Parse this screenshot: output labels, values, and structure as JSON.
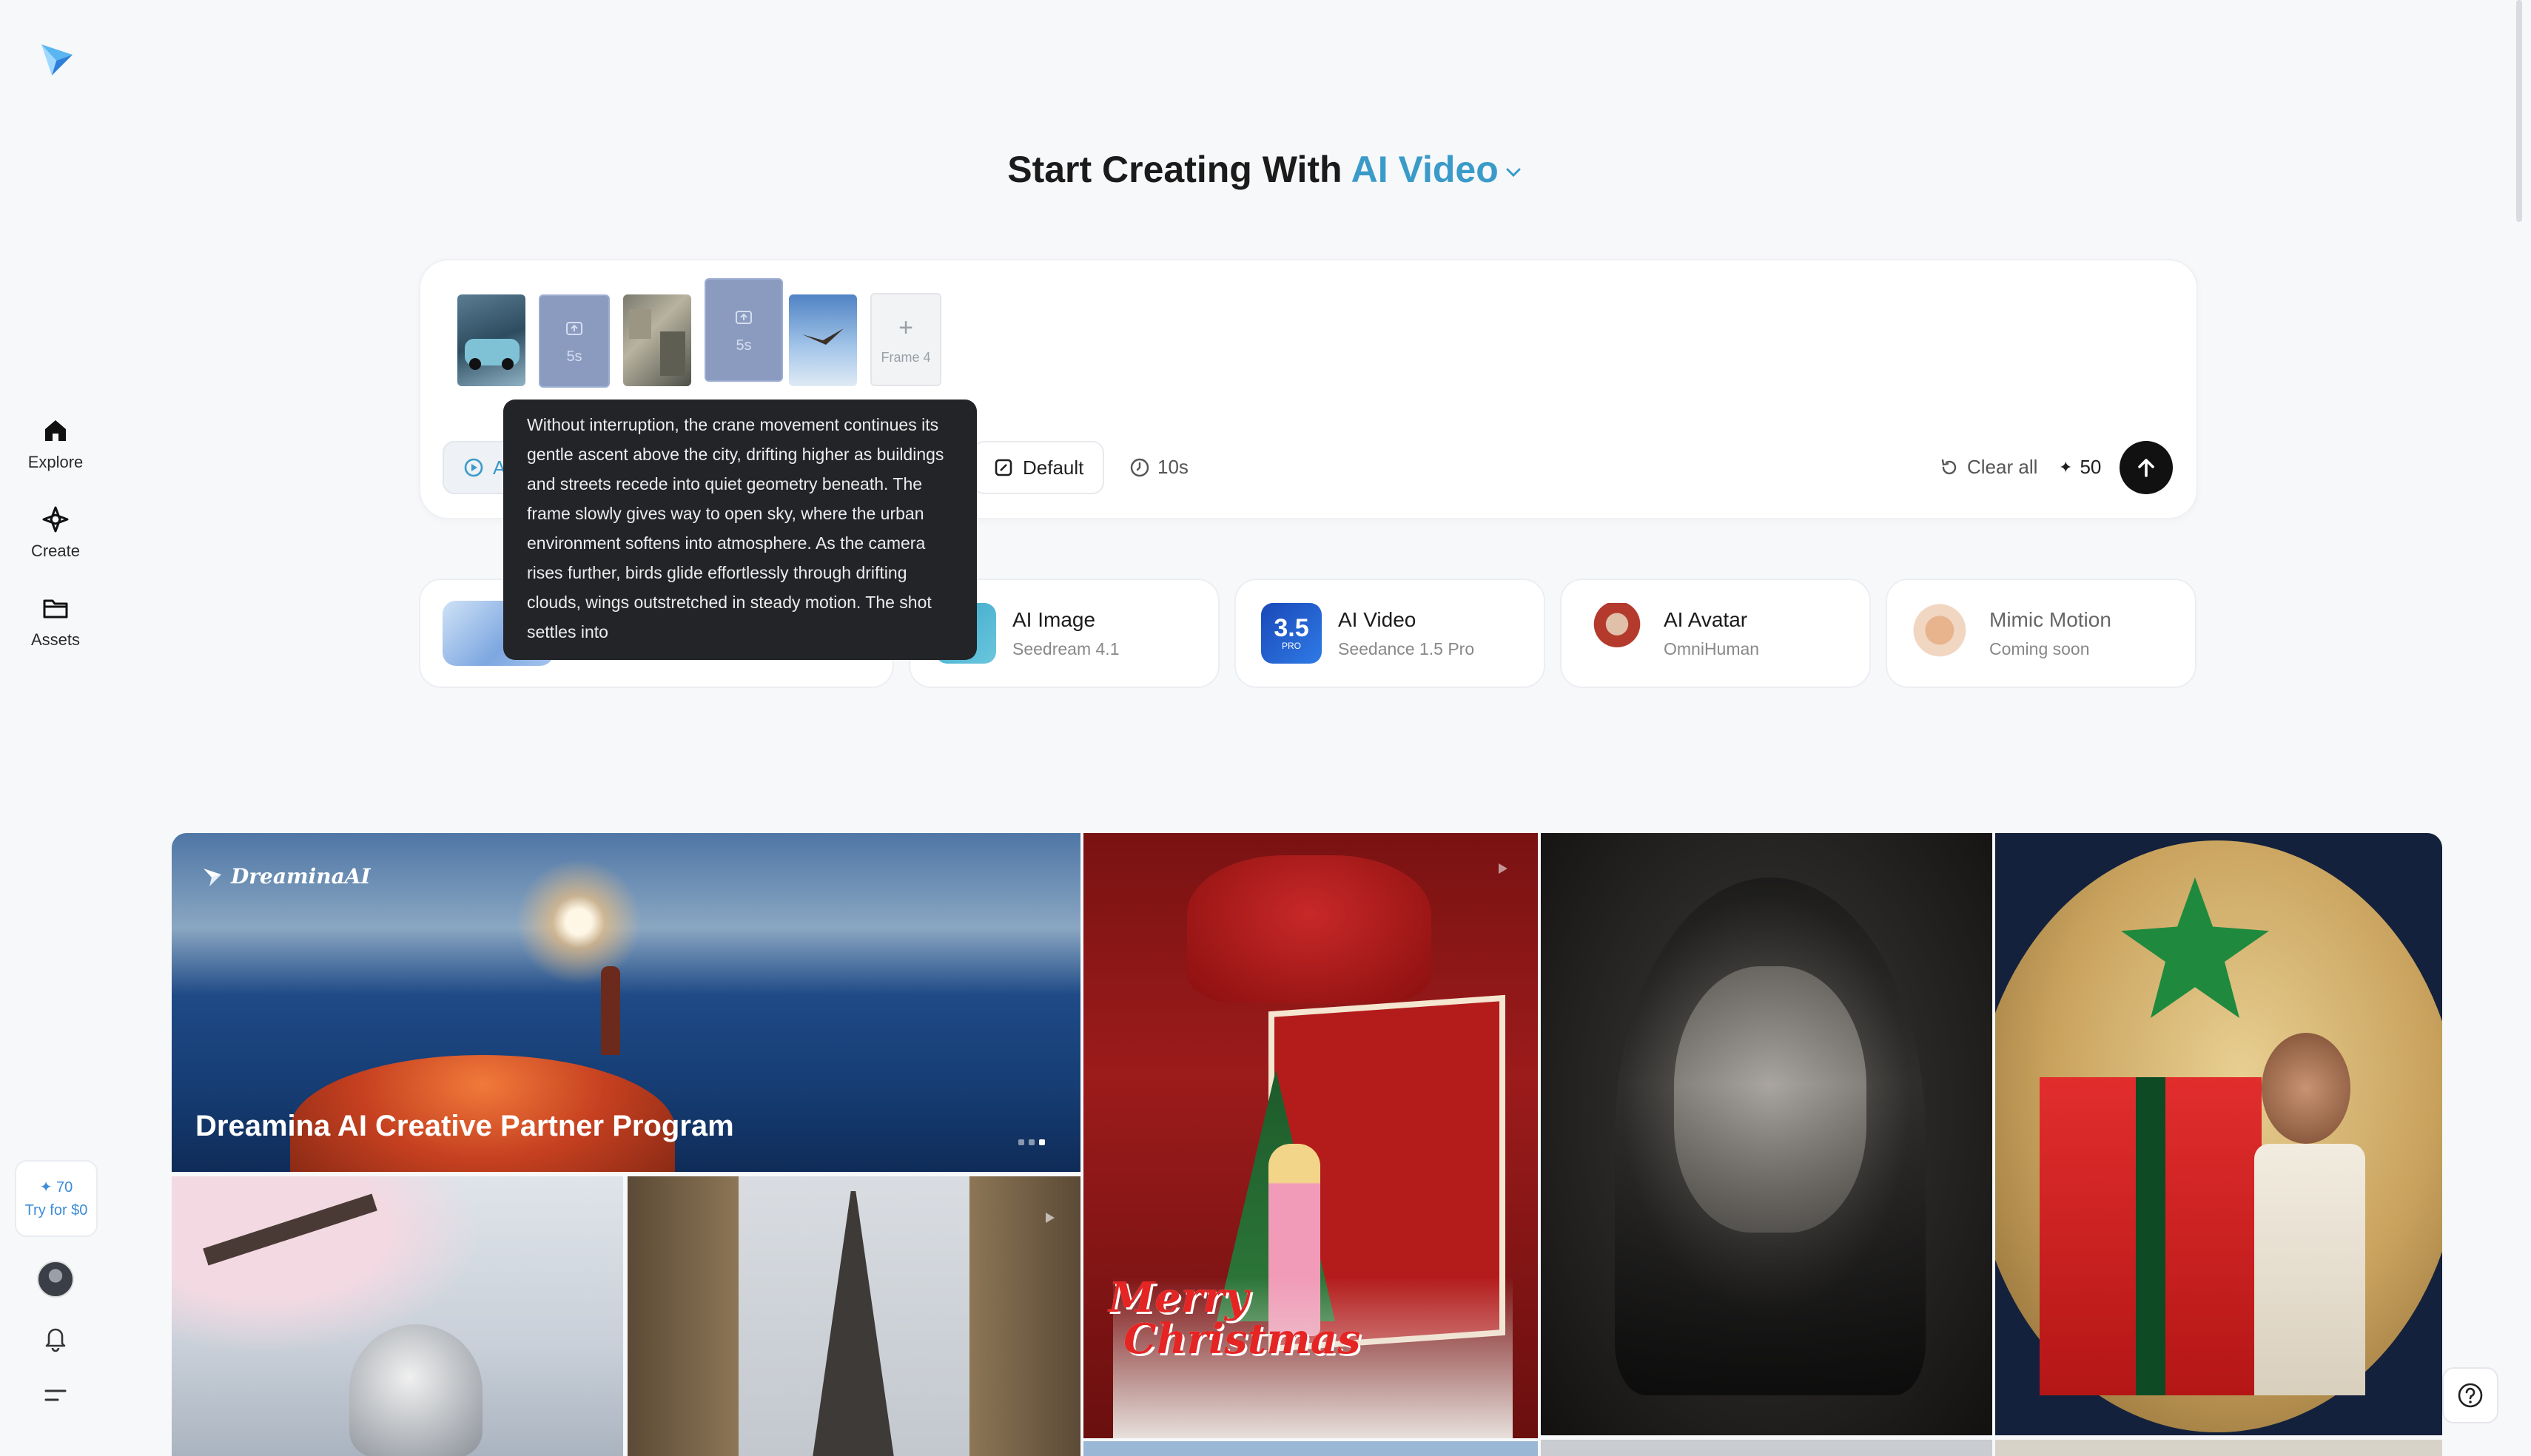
{
  "sidebar": {
    "items": [
      {
        "label": "Explore",
        "icon": "home-icon"
      },
      {
        "label": "Create",
        "icon": "sparkle-icon"
      },
      {
        "label": "Assets",
        "icon": "folder-icon"
      }
    ],
    "credits": {
      "amount": "70",
      "cta": "Try for $0"
    }
  },
  "heading": {
    "prefix": "Start Creating With",
    "mode": "AI Video"
  },
  "prompt": {
    "frames": [
      {
        "kind": "image",
        "desc": "car"
      },
      {
        "kind": "placeholder",
        "duration": "5s"
      },
      {
        "kind": "image",
        "desc": "city"
      },
      {
        "kind": "placeholder",
        "duration": "5s"
      },
      {
        "kind": "image",
        "desc": "bird"
      },
      {
        "kind": "add",
        "label": "Frame 4"
      }
    ],
    "mode_pill_partial": "A",
    "ratio_label": "Default",
    "duration_label": "10s",
    "clear_label": "Clear all",
    "cost": "50"
  },
  "tooltip": {
    "text": "Without interruption, the crane movement continues its gentle ascent above the city, drifting higher as buildings and streets recede into quiet geometry beneath. The frame slowly gives way to open sky, where the urban environment softens into atmosphere. As the camera rises further, birds glide effortlessly through drifting clouds, wings outstretched in steady motion. The shot settles into"
  },
  "tools": [
    {
      "title": "AI Image",
      "sub": "Seedream 4.1"
    },
    {
      "title": "AI Video",
      "sub": "Seedance 1.5 Pro",
      "badge": "3.5",
      "badge_sub": "PRO"
    },
    {
      "title": "AI Avatar",
      "sub": "OmniHuman"
    },
    {
      "title": "Mimic Motion",
      "sub": "Coming soon"
    }
  ],
  "gallery": {
    "banner_title": "Dreamina AI Creative Partner Program",
    "brand": "DreaminaAI",
    "xmas_text_1": "Merry",
    "xmas_text_2": "Christmas"
  },
  "colors": {
    "accent": "#3a9bc9",
    "background": "#f7f8fa",
    "tooltip_bg": "#232428"
  }
}
